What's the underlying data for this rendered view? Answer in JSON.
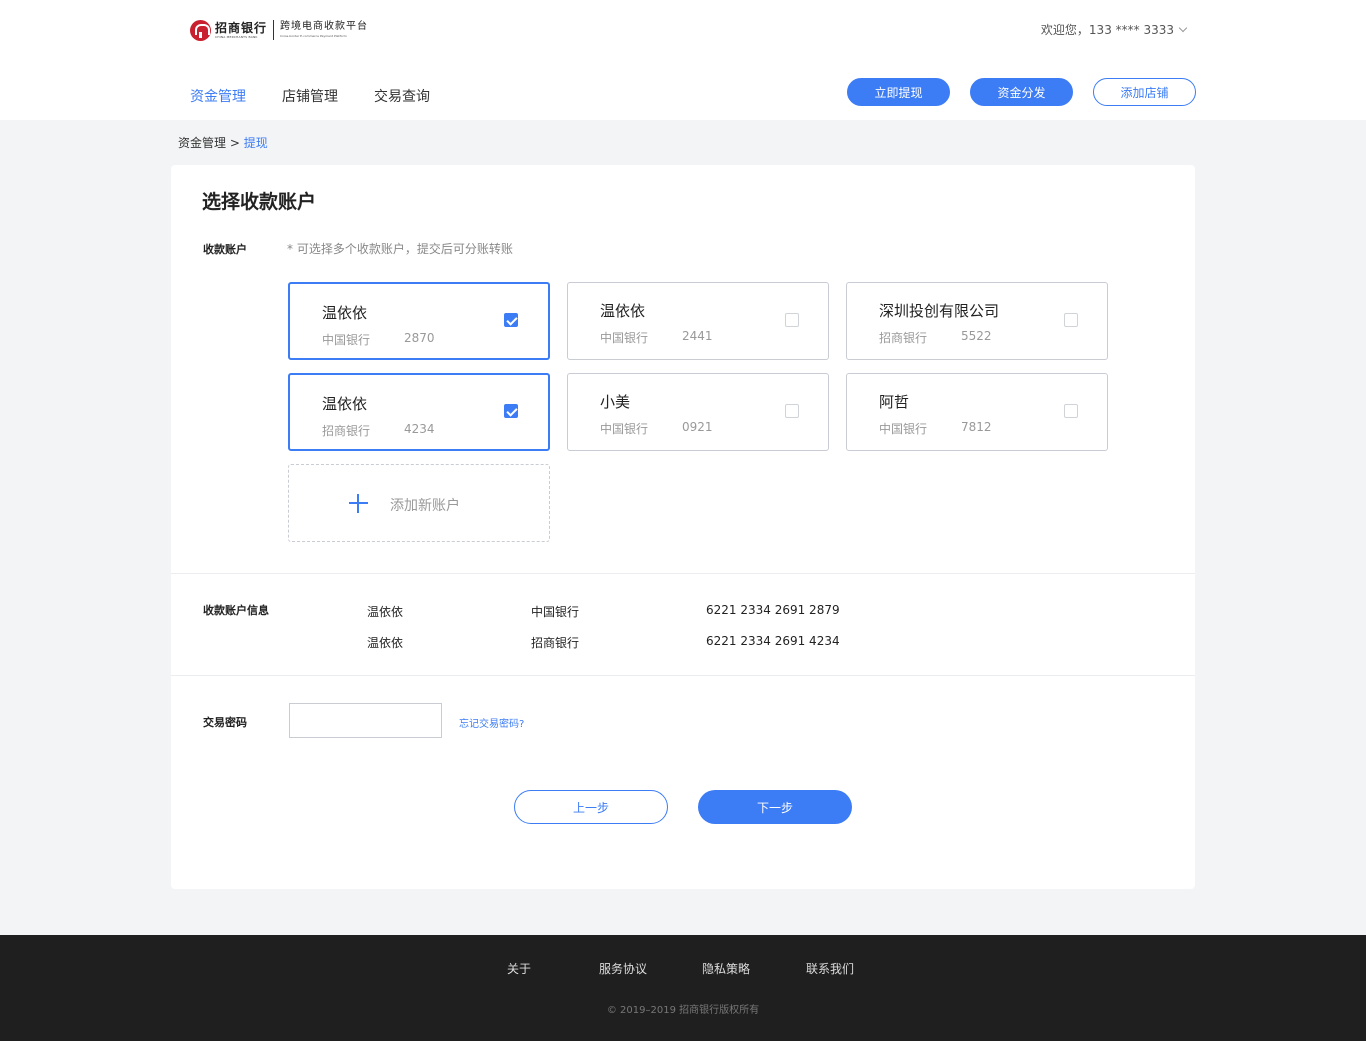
{
  "header": {
    "logo_bank_cn": "招商银行",
    "logo_bank_en": "CHINA MERCHANTS BANK",
    "logo_platform_cn": "跨境电商收款平台",
    "logo_platform_en": "Cross-border E-commerce Payment Platform",
    "welcome": "欢迎您，133 **** 3333",
    "nav": [
      "资金管理",
      "店铺管理",
      "交易查询"
    ],
    "buttons": {
      "withdraw": "立即提现",
      "distribute": "资金分发",
      "add_store": "添加店铺"
    }
  },
  "breadcrumb": {
    "parent": "资金管理",
    "separator": " > ",
    "current": "提现"
  },
  "card": {
    "title": "选择收款账户",
    "account_label": "收款账户",
    "hint": "* 可选择多个收款账户，提交后可分账转账",
    "accounts": [
      {
        "name": "温依依",
        "bank": "中国银行",
        "number": "2870",
        "selected": true
      },
      {
        "name": "温依依",
        "bank": "中国银行",
        "number": "2441",
        "selected": false
      },
      {
        "name": "深圳投创有限公司",
        "bank": "招商银行",
        "number": "5522",
        "selected": false
      },
      {
        "name": "温依依",
        "bank": "招商银行",
        "number": "4234",
        "selected": true
      },
      {
        "name": "小美",
        "bank": "中国银行",
        "number": "0921",
        "selected": false
      },
      {
        "name": "阿哲",
        "bank": "中国银行",
        "number": "7812",
        "selected": false
      }
    ],
    "add_account": "添加新账户",
    "info_label": "收款账户信息",
    "info_rows": [
      {
        "name": "温依依",
        "bank": "中国银行",
        "card": "6221 2334 2691 2879"
      },
      {
        "name": "温依依",
        "bank": "招商银行",
        "card": "6221 2334 2691 4234"
      }
    ],
    "password_label": "交易密码",
    "password_value": "",
    "forgot": "忘记交易密码?",
    "prev": "上一步",
    "next": "下一步"
  },
  "footer": {
    "links": [
      "关于",
      "服务协议",
      "隐私策略",
      "联系我们"
    ],
    "copyright": "© 2019–2019  招商银行版权所有"
  },
  "colors": {
    "accent": "#3c7cf5",
    "footer_bg": "#1f1f1f",
    "page_bg": "#f3f4f6"
  }
}
